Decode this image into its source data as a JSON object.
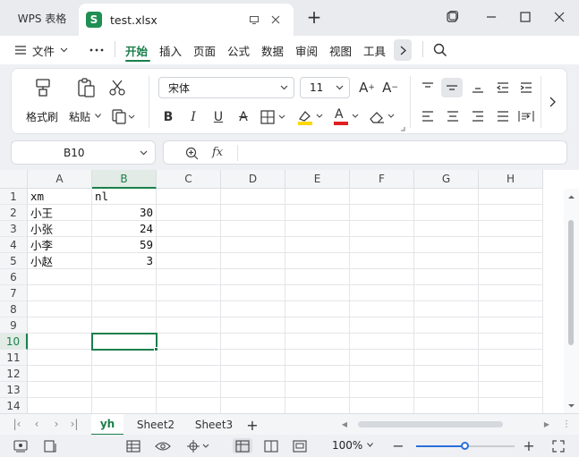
{
  "titlebar": {
    "home_tab_label": "WPS 表格",
    "doc_icon_letter": "S",
    "doc_tab_label": "test.xlsx",
    "new_tab_symbol": "+"
  },
  "menubar": {
    "file_label": "文件",
    "items": [
      "开始",
      "插入",
      "页面",
      "公式",
      "数据",
      "审阅",
      "视图",
      "工具"
    ],
    "active_item": "开始"
  },
  "ribbon": {
    "format_painter_label": "格式刷",
    "paste_label": "粘贴",
    "font_name": "宋体",
    "font_size": "11",
    "bold": "B",
    "italic": "I",
    "underline": "U",
    "strike": "A",
    "font_color_letter": "A",
    "font_color": "#e02020",
    "highlight_color": "#ffd800"
  },
  "formula_bar": {
    "name_box_value": "B10",
    "fx_label": "fx",
    "formula_value": ""
  },
  "sheet": {
    "columns": [
      "A",
      "B",
      "C",
      "D",
      "E",
      "F",
      "G",
      "H"
    ],
    "rows": [
      "1",
      "2",
      "3",
      "4",
      "5",
      "6",
      "7",
      "8",
      "9",
      "10",
      "11",
      "12",
      "13",
      "14"
    ],
    "selected_cell": "B10",
    "cells": {
      "A1": "xm",
      "B1": "nl",
      "A2": "小王",
      "B2": "30",
      "A3": "小张",
      "B3": "24",
      "A4": "小李",
      "B4": "59",
      "A5": "小赵",
      "B5": "3"
    }
  },
  "sheet_tabs": {
    "tabs": [
      "yh",
      "Sheet2",
      "Sheet3"
    ],
    "active": "yh",
    "add_symbol": "+"
  },
  "statusbar": {
    "zoom_label": "100%",
    "zoom_fraction": 0.49
  },
  "accent_color": "#1a7f4b"
}
